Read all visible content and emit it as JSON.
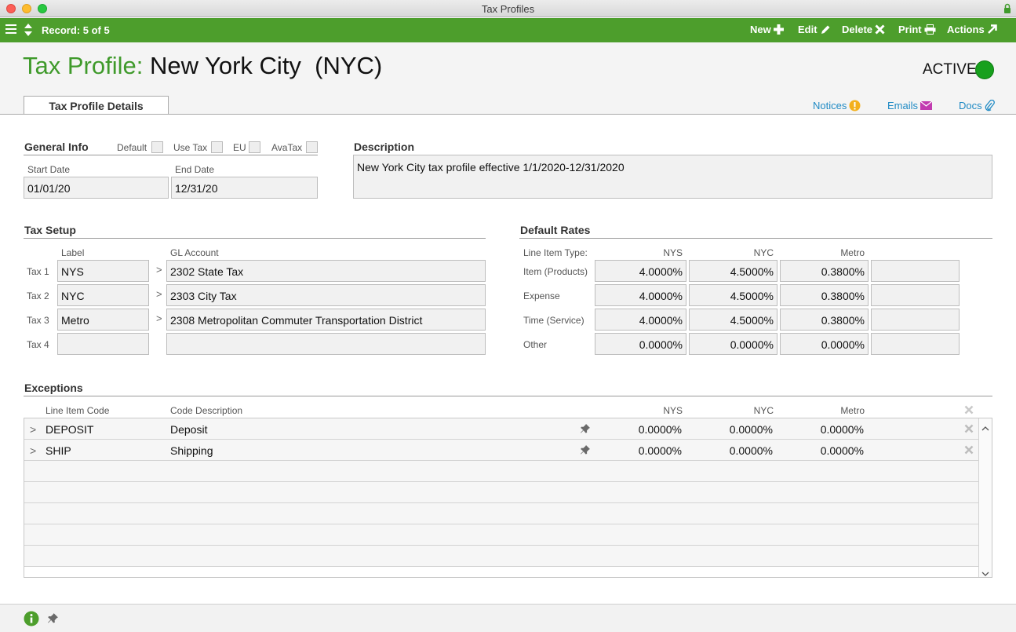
{
  "window": {
    "title": "Tax Profiles"
  },
  "toolbar": {
    "record": "Record: 5 of 5",
    "buttons": {
      "new": "New",
      "edit": "Edit",
      "delete": "Delete",
      "print": "Print",
      "actions": "Actions"
    }
  },
  "header": {
    "label": "Tax Profile:",
    "name": "New York City  (NYC)",
    "status": "ACTIVE",
    "status_color": "#17a01d"
  },
  "tabs": [
    {
      "label": "Tax Profile Details"
    }
  ],
  "links": {
    "notices": "Notices",
    "emails": "Emails",
    "docs": "Docs"
  },
  "general_info": {
    "title": "General Info",
    "checkboxes": {
      "default": "Default",
      "use_tax": "Use Tax",
      "eu": "EU",
      "avatax": "AvaTax"
    },
    "start_date_label": "Start Date",
    "start_date": "01/01/20",
    "end_date_label": "End Date",
    "end_date": "12/31/20"
  },
  "description": {
    "title": "Description",
    "value": "New York City tax profile effective 1/1/2020-12/31/2020"
  },
  "tax_setup": {
    "title": "Tax Setup",
    "col_label": "Label",
    "col_gl": "GL Account",
    "arrow": ">",
    "rows": [
      {
        "name": "Tax 1",
        "label": "NYS",
        "gl": "2302 State Tax"
      },
      {
        "name": "Tax 2",
        "label": "NYC",
        "gl": "2303 City Tax"
      },
      {
        "name": "Tax 3",
        "label": "Metro",
        "gl": "2308 Metropolitan Commuter Transportation District"
      },
      {
        "name": "Tax 4",
        "label": "",
        "gl": ""
      }
    ]
  },
  "default_rates": {
    "title": "Default Rates",
    "type_header": "Line Item Type:",
    "cols": [
      "NYS",
      "NYC",
      "Metro"
    ],
    "rows": [
      {
        "type": "Item (Products)",
        "nys": "4.0000%",
        "nyc": "4.5000%",
        "metro": "0.3800%",
        "extra": ""
      },
      {
        "type": "Expense",
        "nys": "4.0000%",
        "nyc": "4.5000%",
        "metro": "0.3800%",
        "extra": ""
      },
      {
        "type": "Time (Service)",
        "nys": "4.0000%",
        "nyc": "4.5000%",
        "metro": "0.3800%",
        "extra": ""
      },
      {
        "type": "Other",
        "nys": "0.0000%",
        "nyc": "0.0000%",
        "metro": "0.0000%",
        "extra": ""
      }
    ]
  },
  "exceptions": {
    "title": "Exceptions",
    "headers": {
      "code": "Line Item Code",
      "desc": "Code Description",
      "nys": "NYS",
      "nyc": "NYC",
      "metro": "Metro"
    },
    "rows": [
      {
        "expander": ">",
        "code": "DEPOSIT",
        "desc": "Deposit",
        "nys": "0.0000%",
        "nyc": "0.0000%",
        "metro": "0.0000%"
      },
      {
        "expander": ">",
        "code": "SHIP",
        "desc": "Shipping",
        "nys": "0.0000%",
        "nyc": "0.0000%",
        "metro": "0.0000%"
      }
    ]
  }
}
